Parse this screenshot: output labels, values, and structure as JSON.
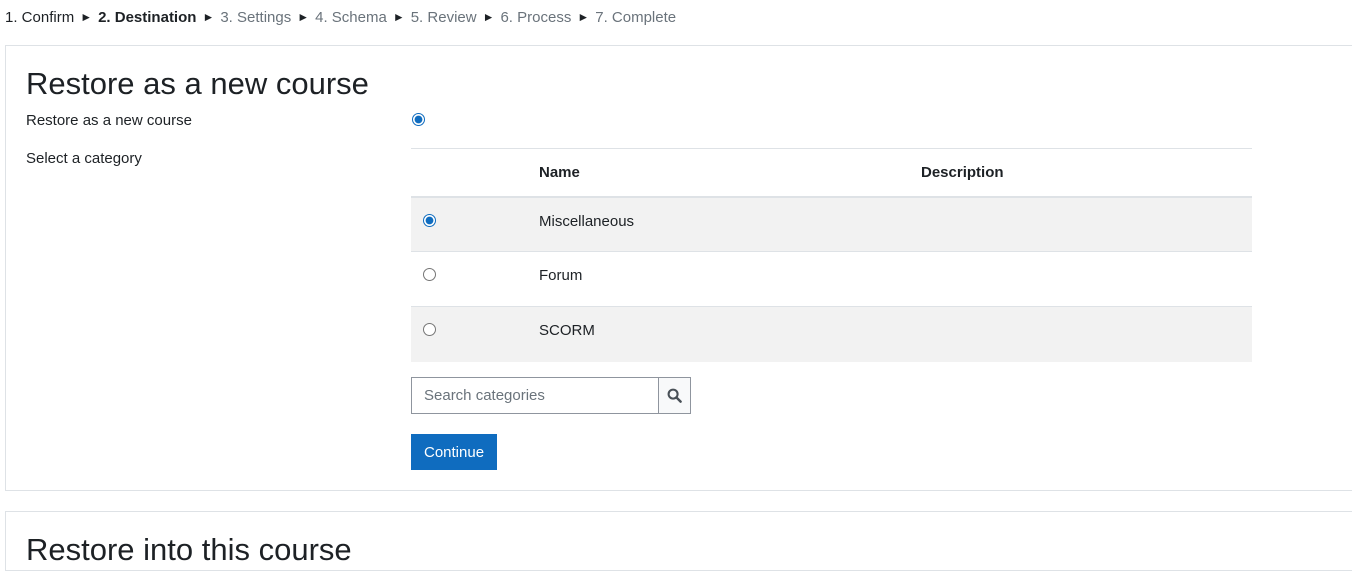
{
  "steps": [
    {
      "label": "1. Confirm",
      "state": "done"
    },
    {
      "label": "2. Destination",
      "state": "current"
    },
    {
      "label": "3. Settings",
      "state": "pending"
    },
    {
      "label": "4. Schema",
      "state": "pending"
    },
    {
      "label": "5. Review",
      "state": "pending"
    },
    {
      "label": "6. Process",
      "state": "pending"
    },
    {
      "label": "7. Complete",
      "state": "pending"
    }
  ],
  "step_separator": "►",
  "new_course": {
    "title": "Restore as a new course",
    "option_label": "Restore as a new course",
    "option_selected": true,
    "category_label": "Select a category",
    "table": {
      "headers": {
        "select": "",
        "name": "Name",
        "description": "Description"
      },
      "rows": [
        {
          "name": "Miscellaneous",
          "description": "",
          "selected": true
        },
        {
          "name": "Forum",
          "description": "",
          "selected": false
        },
        {
          "name": "SCORM",
          "description": "",
          "selected": false
        }
      ]
    },
    "search": {
      "placeholder": "Search categories",
      "value": ""
    },
    "continue_label": "Continue"
  },
  "existing_course": {
    "title": "Restore into this course"
  },
  "colors": {
    "primary": "#0f6cbf",
    "text": "#1d2125",
    "muted": "#6a737b",
    "stripe": "#f2f2f2",
    "border": "#dee2e6"
  }
}
